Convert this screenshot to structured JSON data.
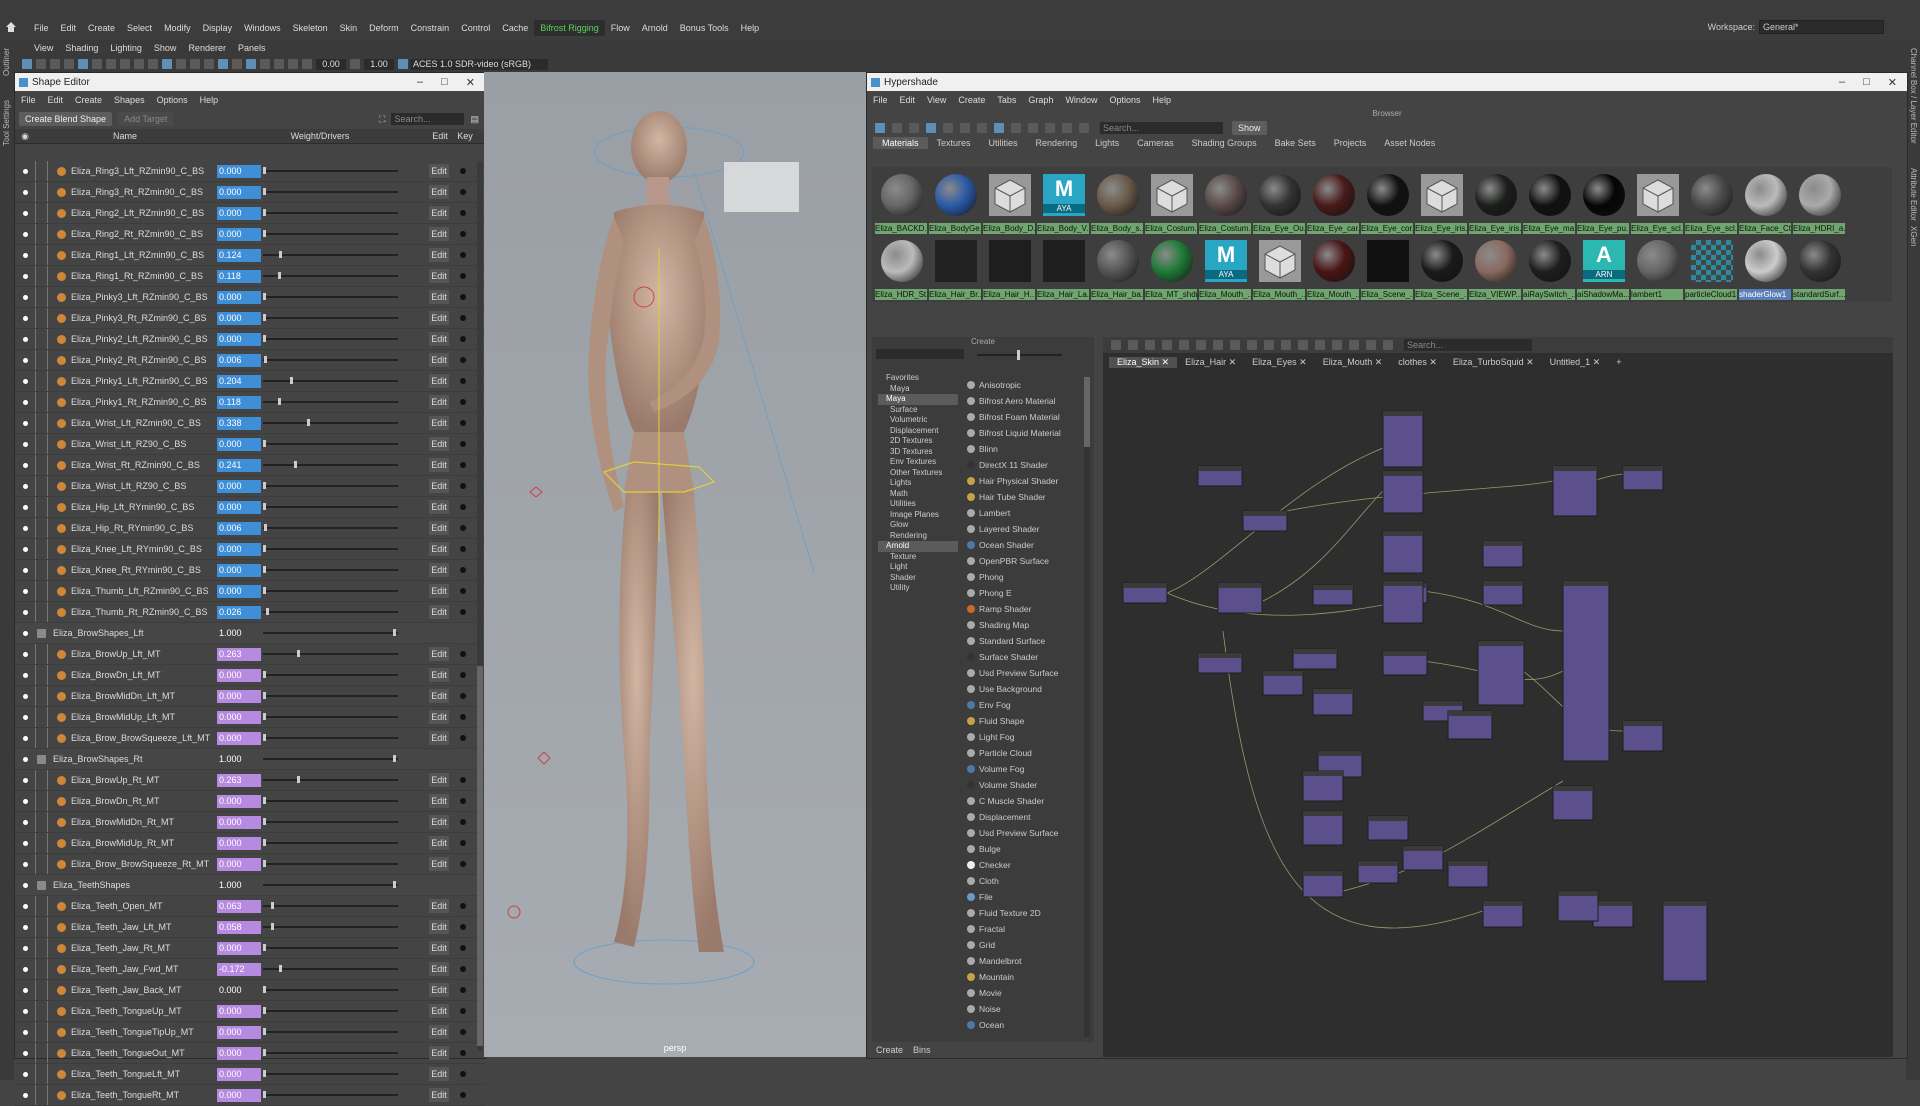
{
  "menubar": {
    "items": [
      "File",
      "Edit",
      "Create",
      "Select",
      "Modify",
      "Display",
      "Windows",
      "Skeleton",
      "Skin",
      "Deform",
      "Constrain",
      "Control",
      "Cache",
      "Bifrost Rigging",
      "Flow",
      "Arnold",
      "Bonus Tools",
      "Help"
    ],
    "workspace_label": "Workspace:",
    "workspace_value": "General*"
  },
  "panel_menu": [
    "View",
    "Shading",
    "Lighting",
    "Show",
    "Renderer",
    "Panels"
  ],
  "toolbar": {
    "num1": "0.00",
    "num2": "1.00",
    "colorspace": "ACES 1.0 SDR-video (sRGB)"
  },
  "side_labels": {
    "left": [
      "Outliner",
      "Tool Settings"
    ],
    "right": [
      "Channel Box / Layer Editor",
      "Attribute Editor",
      "XGen"
    ]
  },
  "shape_editor": {
    "title": "Shape Editor",
    "menu": [
      "File",
      "Edit",
      "Create",
      "Shapes",
      "Options",
      "Help"
    ],
    "create_blend_label": "Create Blend Shape",
    "add_target_label": "Add Target",
    "search_placeholder": "Search...",
    "col_name": "Name",
    "col_weight": "Weight/Drivers",
    "col_edit": "Edit",
    "col_key": "Key",
    "rows": [
      {
        "name": "Eliza_Ring3_Lft_RZmin90_C_BS",
        "value": "0.000",
        "group": false,
        "color": "blue",
        "pos": 0.0
      },
      {
        "name": "Eliza_Ring3_Rt_RZmin90_C_BS",
        "value": "0.000",
        "group": false,
        "color": "blue",
        "pos": 0.0
      },
      {
        "name": "Eliza_Ring2_Lft_RZmin90_C_BS",
        "value": "0.000",
        "group": false,
        "color": "blue",
        "pos": 0.0
      },
      {
        "name": "Eliza_Ring2_Rt_RZmin90_C_BS",
        "value": "0.000",
        "group": false,
        "color": "blue",
        "pos": 0.0
      },
      {
        "name": "Eliza_Ring1_Lft_RZmin90_C_BS",
        "value": "0.124",
        "group": false,
        "color": "blue",
        "pos": 0.124
      },
      {
        "name": "Eliza_Ring1_Rt_RZmin90_C_BS",
        "value": "0.118",
        "group": false,
        "color": "blue",
        "pos": 0.118
      },
      {
        "name": "Eliza_Pinky3_Lft_RZmin90_C_BS",
        "value": "0.000",
        "group": false,
        "color": "blue",
        "pos": 0.0
      },
      {
        "name": "Eliza_Pinky3_Rt_RZmin90_C_BS",
        "value": "0.000",
        "group": false,
        "color": "blue",
        "pos": 0.0
      },
      {
        "name": "Eliza_Pinky2_Lft_RZmin90_C_BS",
        "value": "0.000",
        "group": false,
        "color": "blue",
        "pos": 0.0
      },
      {
        "name": "Eliza_Pinky2_Rt_RZmin90_C_BS",
        "value": "0.006",
        "group": false,
        "color": "blue",
        "pos": 0.006
      },
      {
        "name": "Eliza_Pinky1_Lft_RZmin90_C_BS",
        "value": "0.204",
        "group": false,
        "color": "blue",
        "pos": 0.204
      },
      {
        "name": "Eliza_Pinky1_Rt_RZmin90_C_BS",
        "value": "0.118",
        "group": false,
        "color": "blue",
        "pos": 0.118
      },
      {
        "name": "Eliza_Wrist_Lft_RZmin90_C_BS",
        "value": "0.338",
        "group": false,
        "color": "blue",
        "pos": 0.338
      },
      {
        "name": "Eliza_Wrist_Lft_RZ90_C_BS",
        "value": "0.000",
        "group": false,
        "color": "blue",
        "pos": 0.0
      },
      {
        "name": "Eliza_Wrist_Rt_RZmin90_C_BS",
        "value": "0.241",
        "group": false,
        "color": "blue",
        "pos": 0.241
      },
      {
        "name": "Eliza_Wrist_Lft_RZ90_C_BS",
        "value": "0.000",
        "group": false,
        "color": "blue",
        "pos": 0.0
      },
      {
        "name": "Eliza_Hip_Lft_RYmin90_C_BS",
        "value": "0.000",
        "group": false,
        "color": "blue",
        "pos": 0.0
      },
      {
        "name": "Eliza_Hip_Rt_RYmin90_C_BS",
        "value": "0.006",
        "group": false,
        "color": "blue",
        "pos": 0.006
      },
      {
        "name": "Eliza_Knee_Lft_RYmin90_C_BS",
        "value": "0.000",
        "group": false,
        "color": "blue",
        "pos": 0.0
      },
      {
        "name": "Eliza_Knee_Rt_RYmin90_C_BS",
        "value": "0.000",
        "group": false,
        "color": "blue",
        "pos": 0.0
      },
      {
        "name": "Eliza_Thumb_Lft_RZmin90_C_BS",
        "value": "0.000",
        "group": false,
        "color": "blue",
        "pos": 0.0
      },
      {
        "name": "Eliza_Thumb_Rt_RZmin90_C_BS",
        "value": "0.026",
        "group": false,
        "color": "blue",
        "pos": 0.026
      },
      {
        "name": "Eliza_BrowShapes_Lft",
        "value": "1.000",
        "group": true,
        "color": "none",
        "pos": 1.0
      },
      {
        "name": "Eliza_BrowUp_Lft_MT",
        "value": "0.263",
        "group": false,
        "color": "violet",
        "pos": 0.263
      },
      {
        "name": "Eliza_BrowDn_Lft_MT",
        "value": "0.000",
        "group": false,
        "color": "violet",
        "pos": 0.0
      },
      {
        "name": "Eliza_BrowMidDn_Lft_MT",
        "value": "0.000",
        "group": false,
        "color": "violet",
        "pos": 0.0
      },
      {
        "name": "Eliza_BrowMidUp_Lft_MT",
        "value": "0.000",
        "group": false,
        "color": "violet",
        "pos": 0.0
      },
      {
        "name": "Eliza_Brow_BrowSqueeze_Lft_MT",
        "value": "0.000",
        "group": false,
        "color": "violet",
        "pos": 0.0
      },
      {
        "name": "Eliza_BrowShapes_Rt",
        "value": "1.000",
        "group": true,
        "color": "none",
        "pos": 1.0
      },
      {
        "name": "Eliza_BrowUp_Rt_MT",
        "value": "0.263",
        "group": false,
        "color": "violet",
        "pos": 0.263
      },
      {
        "name": "Eliza_BrowDn_Rt_MT",
        "value": "0.000",
        "group": false,
        "color": "violet",
        "pos": 0.0
      },
      {
        "name": "Eliza_BrowMidDn_Rt_MT",
        "value": "0.000",
        "group": false,
        "color": "violet",
        "pos": 0.0
      },
      {
        "name": "Eliza_BrowMidUp_Rt_MT",
        "value": "0.000",
        "group": false,
        "color": "violet",
        "pos": 0.0
      },
      {
        "name": "Eliza_Brow_BrowSqueeze_Rt_MT",
        "value": "0.000",
        "group": false,
        "color": "violet",
        "pos": 0.0
      },
      {
        "name": "Eliza_TeethShapes",
        "value": "1.000",
        "group": true,
        "color": "none",
        "pos": 1.0
      },
      {
        "name": "Eliza_Teeth_Open_MT",
        "value": "0.063",
        "group": false,
        "color": "violet",
        "pos": 0.063
      },
      {
        "name": "Eliza_Teeth_Jaw_Lft_MT",
        "value": "0.058",
        "group": false,
        "color": "violet",
        "pos": 0.058
      },
      {
        "name": "Eliza_Teeth_Jaw_Rt_MT",
        "value": "0.000",
        "group": false,
        "color": "violet",
        "pos": 0.0
      },
      {
        "name": "Eliza_Teeth_Jaw_Fwd_MT",
        "value": "-0.172",
        "group": false,
        "color": "violet",
        "pos": 0.12
      },
      {
        "name": "Eliza_Teeth_Jaw_Back_MT",
        "value": "0.000",
        "group": false,
        "color": "none",
        "pos": 0.0
      },
      {
        "name": "Eliza_Teeth_TongueUp_MT",
        "value": "0.000",
        "group": false,
        "color": "violet",
        "pos": 0.0
      },
      {
        "name": "Eliza_Teeth_TongueTipUp_MT",
        "value": "0.000",
        "group": false,
        "color": "violet",
        "pos": 0.0
      },
      {
        "name": "Eliza_Teeth_TongueOut_MT",
        "value": "0.000",
        "group": false,
        "color": "violet",
        "pos": 0.0
      },
      {
        "name": "Eliza_Teeth_TongueLft_MT",
        "value": "0.000",
        "group": false,
        "color": "violet",
        "pos": 0.0
      },
      {
        "name": "Eliza_Teeth_TongueRt_MT",
        "value": "0.000",
        "group": false,
        "color": "violet",
        "pos": 0.0
      }
    ]
  },
  "viewport": {
    "camera_label": "persp"
  },
  "hypershade": {
    "title": "Hypershade",
    "menu": [
      "File",
      "Edit",
      "View",
      "Create",
      "Tabs",
      "Graph",
      "Window",
      "Options",
      "Help"
    ],
    "browser_label": "Browser",
    "search_placeholder": "Search...",
    "show_label": "Show",
    "browser_tabs": [
      "Materials",
      "Textures",
      "Utilities",
      "Rendering",
      "Lights",
      "Cameras",
      "Shading Groups",
      "Bake Sets",
      "Projects",
      "Asset Nodes"
    ],
    "swatches_row1": [
      {
        "label": "Eliza_BACKD...",
        "color": "#666",
        "kind": "ball",
        "sel": false
      },
      {
        "label": "Eliza_BodyGe...",
        "color": "#2a5aa8",
        "kind": "ball",
        "sel": false
      },
      {
        "label": "Eliza_Body_D...",
        "color": "#999",
        "kind": "cube",
        "sel": false
      },
      {
        "label": "Eliza_Body_V...",
        "color": "#29a6c4",
        "kind": "AYA",
        "sel": false
      },
      {
        "label": "Eliza_Body_s...",
        "color": "#6a5a4a",
        "kind": "ball",
        "sel": false
      },
      {
        "label": "Eliza_Costum...",
        "color": "#999",
        "kind": "cube",
        "sel": false
      },
      {
        "label": "Eliza_Costum...",
        "color": "#5a4a48",
        "kind": "ball",
        "sel": false
      },
      {
        "label": "Eliza_Eye_Ou...",
        "color": "#333",
        "kind": "ball",
        "sel": false
      },
      {
        "label": "Eliza_Eye_car...",
        "color": "#4a1a1a",
        "kind": "ball",
        "sel": false
      },
      {
        "label": "Eliza_Eye_cor...",
        "color": "#111",
        "kind": "ball",
        "sel": false
      },
      {
        "label": "Eliza_Eye_iris...",
        "color": "#999",
        "kind": "cube",
        "sel": false
      },
      {
        "label": "Eliza_Eye_iris...",
        "color": "#1b1e1b",
        "kind": "ball",
        "sel": false
      },
      {
        "label": "Eliza_Eye_ma...",
        "color": "#111",
        "kind": "ball",
        "sel": false
      },
      {
        "label": "Eliza_Eye_pu...",
        "color": "#050505",
        "kind": "ball",
        "sel": false
      },
      {
        "label": "Eliza_Eye_scl...",
        "color": "#999",
        "kind": "cube",
        "sel": false
      },
      {
        "label": "Eliza_Eye_scl...",
        "color": "#4a4a4a",
        "kind": "ball",
        "sel": false
      },
      {
        "label": "Eliza_Face_Ct...",
        "color": "#bbb",
        "kind": "ball",
        "sel": false
      },
      {
        "label": "Eliza_HDRI_a...",
        "color": "#aaa",
        "kind": "ball",
        "sel": false
      }
    ],
    "swatches_row2": [
      {
        "label": "Eliza_HDR_St...",
        "color": "#bbb",
        "kind": "ball",
        "sel": false
      },
      {
        "label": "Eliza_Hair_Br...",
        "color": "#222",
        "kind": "flat",
        "sel": false
      },
      {
        "label": "Eliza_Hair_H...",
        "color": "#1e1e1e",
        "kind": "flat",
        "sel": false
      },
      {
        "label": "Eliza_Hair_La...",
        "color": "#1e1e1e",
        "kind": "flat",
        "sel": false
      },
      {
        "label": "Eliza_Hair_ba...",
        "color": "#555",
        "kind": "ball",
        "sel": false
      },
      {
        "label": "Eliza_MT_shdr",
        "color": "#1e7a36",
        "kind": "ball",
        "sel": false
      },
      {
        "label": "Eliza_Mouth_...",
        "color": "#29a6c4",
        "kind": "AYA",
        "sel": false
      },
      {
        "label": "Eliza_Mouth_...",
        "color": "#999",
        "kind": "cube",
        "sel": false
      },
      {
        "label": "Eliza_Mouth_...",
        "color": "#4a1414",
        "kind": "ball",
        "sel": false
      },
      {
        "label": "Eliza_Scene_...",
        "color": "#111",
        "kind": "flat",
        "sel": false
      },
      {
        "label": "Eliza_Scene_...",
        "color": "#1a1a1a",
        "kind": "ball",
        "sel": false
      },
      {
        "label": "Eliza_VIEWP...",
        "color": "#8a6a60",
        "kind": "ball",
        "sel": false
      },
      {
        "label": "aiRaySwitch_...",
        "color": "#1e1e1e",
        "kind": "ball",
        "sel": false
      },
      {
        "label": "aiShadowMa...",
        "color": "#2bb8b0",
        "kind": "ARN",
        "sel": false
      },
      {
        "label": "lambert1",
        "color": "#666",
        "kind": "ball",
        "sel": false
      },
      {
        "label": "particleCloud1",
        "color": "#8aa0a8",
        "kind": "checker",
        "sel": false
      },
      {
        "label": "shaderGlow1",
        "color": "#ccc",
        "kind": "ball",
        "sel": true
      },
      {
        "label": "standardSurf...",
        "color": "#333",
        "kind": "ball",
        "sel": false
      }
    ],
    "create_label": "Create",
    "tree": [
      {
        "t": "Favorites",
        "ind": 0,
        "sel": false
      },
      {
        "t": "Maya",
        "ind": 1,
        "sel": false
      },
      {
        "t": "Maya",
        "ind": 0,
        "sel": true
      },
      {
        "t": "Surface",
        "ind": 1,
        "sel": false
      },
      {
        "t": "Volumetric",
        "ind": 1,
        "sel": false
      },
      {
        "t": "Displacement",
        "ind": 1,
        "sel": false
      },
      {
        "t": "2D Textures",
        "ind": 1,
        "sel": false
      },
      {
        "t": "3D Textures",
        "ind": 1,
        "sel": false
      },
      {
        "t": "Env Textures",
        "ind": 1,
        "sel": false
      },
      {
        "t": "Other Textures",
        "ind": 1,
        "sel": false
      },
      {
        "t": "Lights",
        "ind": 1,
        "sel": false
      },
      {
        "t": "Math",
        "ind": 1,
        "sel": false
      },
      {
        "t": "Utilities",
        "ind": 1,
        "sel": false
      },
      {
        "t": "Image Planes",
        "ind": 1,
        "sel": false
      },
      {
        "t": "Glow",
        "ind": 1,
        "sel": false
      },
      {
        "t": "Rendering",
        "ind": 1,
        "sel": false
      },
      {
        "t": "Arnold",
        "ind": 0,
        "sel": true
      },
      {
        "t": "Texture",
        "ind": 1,
        "sel": false
      },
      {
        "t": "Light",
        "ind": 1,
        "sel": false
      },
      {
        "t": "Shader",
        "ind": 1,
        "sel": false
      },
      {
        "t": "Utility",
        "ind": 1,
        "sel": false
      }
    ],
    "shaders": [
      {
        "t": "Anisotropic",
        "c": "#aaa"
      },
      {
        "t": "Bifrost Aero Material",
        "c": "#aaa"
      },
      {
        "t": "Bifrost Foam Material",
        "c": "#aaa"
      },
      {
        "t": "Bifrost Liquid Material",
        "c": "#aaa"
      },
      {
        "t": "Blinn",
        "c": "#aaa"
      },
      {
        "t": "DirectX 11 Shader",
        "c": "#333"
      },
      {
        "t": "Hair Physical Shader",
        "c": "#c8a048"
      },
      {
        "t": "Hair Tube Shader",
        "c": "#c8a048"
      },
      {
        "t": "Lambert",
        "c": "#aaa"
      },
      {
        "t": "Layered Shader",
        "c": "#aaa"
      },
      {
        "t": "Ocean Shader",
        "c": "#4a7aa8"
      },
      {
        "t": "OpenPBR Surface",
        "c": "#aaa"
      },
      {
        "t": "Phong",
        "c": "#aaa"
      },
      {
        "t": "Phong E",
        "c": "#aaa"
      },
      {
        "t": "Ramp Shader",
        "c": "#c86a2a"
      },
      {
        "t": "Shading Map",
        "c": "#aaa"
      },
      {
        "t": "Standard Surface",
        "c": "#aaa"
      },
      {
        "t": "Surface Shader",
        "c": "#333"
      },
      {
        "t": "Usd Preview Surface",
        "c": "#aaa"
      },
      {
        "t": "Use Background",
        "c": "#aaa"
      },
      {
        "t": "Env Fog",
        "c": "#4a7aa8"
      },
      {
        "t": "Fluid Shape",
        "c": "#c8a048"
      },
      {
        "t": "Light Fog",
        "c": "#aaa"
      },
      {
        "t": "Particle Cloud",
        "c": "#aaa"
      },
      {
        "t": "Volume Fog",
        "c": "#4a7aa8"
      },
      {
        "t": "Volume Shader",
        "c": "#333"
      },
      {
        "t": "C Muscle Shader",
        "c": "#aaa"
      },
      {
        "t": "Displacement",
        "c": "#aaa"
      },
      {
        "t": "Usd Preview Surface",
        "c": "#aaa"
      },
      {
        "t": "Bulge",
        "c": "#aaa"
      },
      {
        "t": "Checker",
        "c": "#eee"
      },
      {
        "t": "Cloth",
        "c": "#aaa"
      },
      {
        "t": "File",
        "c": "#6a9ac8"
      },
      {
        "t": "Fluid Texture 2D",
        "c": "#aaa"
      },
      {
        "t": "Fractal",
        "c": "#aaa"
      },
      {
        "t": "Grid",
        "c": "#aaa"
      },
      {
        "t": "Mandelbrot",
        "c": "#aaa"
      },
      {
        "t": "Mountain",
        "c": "#c8a048"
      },
      {
        "t": "Movie",
        "c": "#aaa"
      },
      {
        "t": "Noise",
        "c": "#aaa"
      },
      {
        "t": "Ocean",
        "c": "#4a7aa8"
      }
    ],
    "bottom_tabs": [
      "Create",
      "Bins"
    ],
    "graph_search_placeholder": "Search...",
    "graph_tabs": [
      "Eliza_Skin",
      "Eliza_Hair",
      "Eliza_Eyes",
      "Eliza_Mouth",
      "clothes",
      "Eliza_TurboSquid",
      "Untitled_1"
    ],
    "plus_label": "+"
  }
}
